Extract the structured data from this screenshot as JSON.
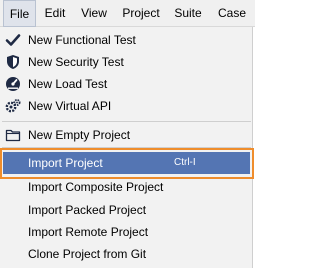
{
  "menubar": {
    "items": [
      {
        "label": "File"
      },
      {
        "label": "Edit"
      },
      {
        "label": "View"
      },
      {
        "label": "Project"
      },
      {
        "label": "Suite"
      },
      {
        "label": "Case"
      }
    ]
  },
  "file_menu": {
    "items": [
      {
        "label": "New Functional Test",
        "icon": "checkmark-icon"
      },
      {
        "label": "New Security Test",
        "icon": "shield-icon"
      },
      {
        "label": "New Load Test",
        "icon": "gauge-icon"
      },
      {
        "label": "New Virtual API",
        "icon": "gears-icon"
      },
      {
        "label": "New Empty Project",
        "icon": "folder-icon"
      },
      {
        "label": "Import Project",
        "shortcut": "Ctrl-I"
      },
      {
        "label": "Import Composite Project"
      },
      {
        "label": "Import Packed Project"
      },
      {
        "label": "Import Remote Project"
      },
      {
        "label": "Clone Project from Git"
      }
    ]
  },
  "colors": {
    "highlight": "#5475b3",
    "focus_ring": "#ef8d2c",
    "menubar_bg": "#f0f0f0",
    "menu_bg": "#f2f2f2"
  }
}
